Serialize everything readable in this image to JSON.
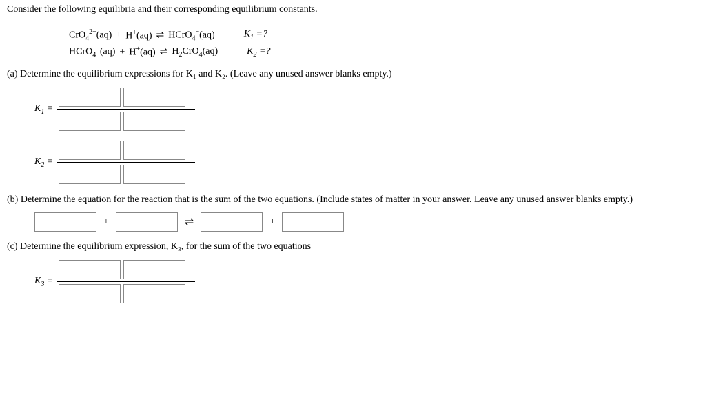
{
  "intro": "Consider the following equilibria and their corresponding equilibrium constants.",
  "eq1": {
    "lhs1": "CrO",
    "lhs1_sub": "4",
    "lhs1_sup": "2−",
    "lhs1_state": "(aq)",
    "plus": "+",
    "lhs2": "H",
    "lhs2_sup": "+",
    "lhs2_state": "(aq)",
    "arrow": "⇌",
    "rhs1": "HCrO",
    "rhs1_sub": "4",
    "rhs1_sup": "−",
    "rhs1_state": "(aq)",
    "klabel": "K",
    "ksub": "1",
    "kq": " =?"
  },
  "eq2": {
    "lhs1": "HCrO",
    "lhs1_sub": "4",
    "lhs1_sup": "−",
    "lhs1_state": "(aq)",
    "plus": "+",
    "lhs2": "H",
    "lhs2_sup": "+",
    "lhs2_state": "(aq)",
    "arrow": "⇌",
    "rhs1": "H",
    "rhs1_sub1": "2",
    "rhs1b": "CrO",
    "rhs1_sub2": "4",
    "rhs1_state": "(aq)",
    "klabel": "K",
    "ksub": "2",
    "kq": " =?"
  },
  "partA": {
    "label": "(a)",
    "text": "Determine the equilibrium expressions for K₁ and K₂. (Leave any unused answer blanks empty.)",
    "k1": "K",
    "k1sub": "1",
    "eq": " =",
    "k2": "K",
    "k2sub": "2"
  },
  "partB": {
    "label": "(b)",
    "text": "Determine the equation for the reaction that is the sum of the two equations. (Include states of matter in your answer. Leave any unused answer blanks empty.)",
    "plus": "+",
    "arrow": "⇌"
  },
  "partC": {
    "label": "(c)",
    "text": "Determine the equilibrium expression, K₃, for the sum of the two equations",
    "k3": "K",
    "k3sub": "3",
    "eq": " ="
  }
}
